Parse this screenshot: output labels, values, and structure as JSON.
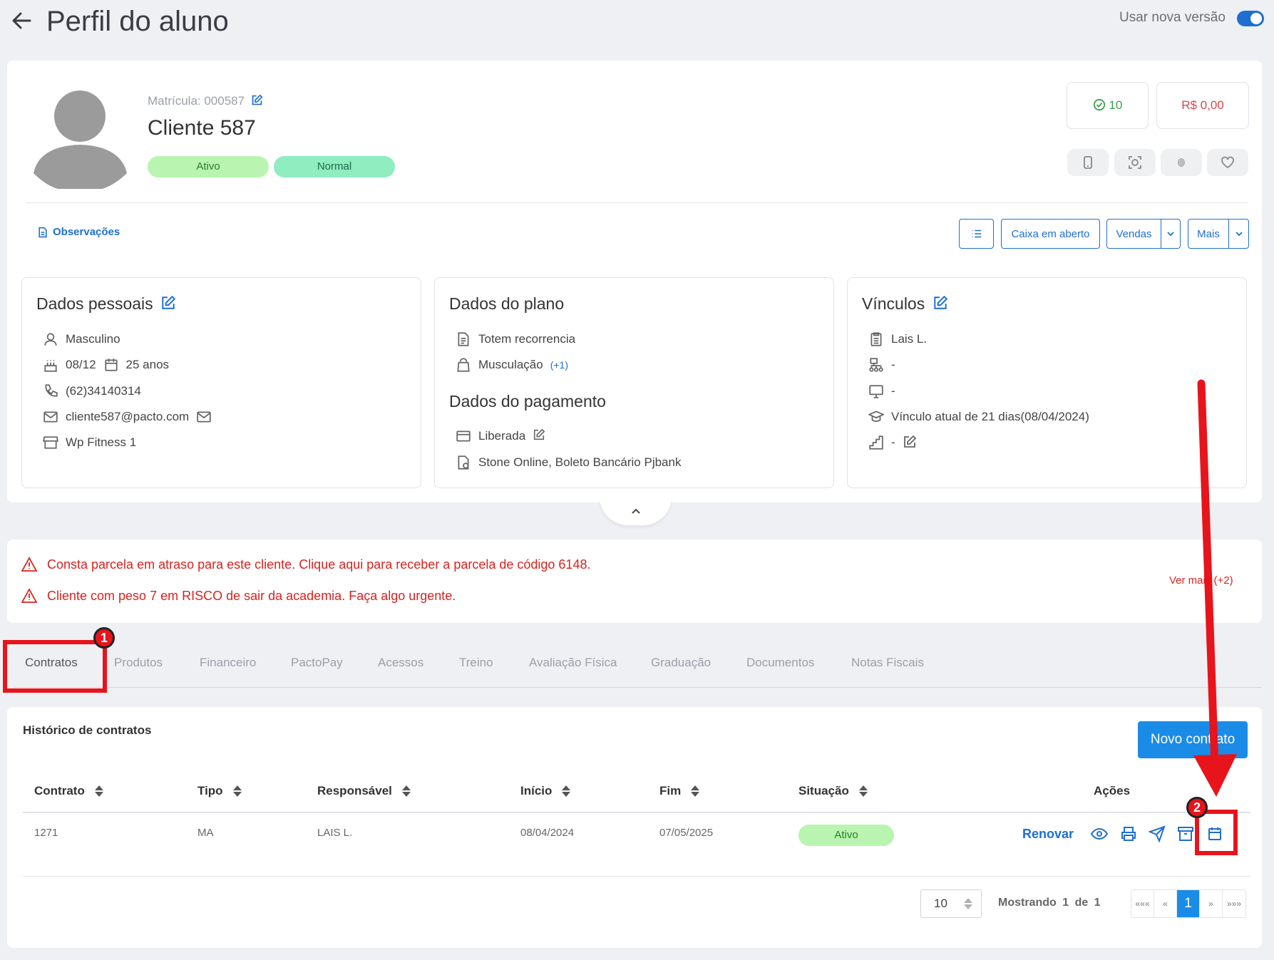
{
  "header": {
    "title": "Perfil do aluno",
    "toggle_label": "Usar nova versão",
    "toggle_on": true
  },
  "profile": {
    "matricula": "Matrícula: 000587",
    "name": "Cliente 587",
    "badges": [
      "Ativo",
      "Normal"
    ],
    "points": "10",
    "balance": "R$ 0,00",
    "observacoes": "Observações"
  },
  "toolbar": {
    "caixa": "Caixa em aberto",
    "vendas": "Vendas",
    "mais": "Mais"
  },
  "personal": {
    "title": "Dados pessoais",
    "gender": "Masculino",
    "birthday": "08/12",
    "age": "25 anos",
    "phone": "(62)34140314",
    "email": "cliente587@pacto.com",
    "unit": "Wp Fitness 1"
  },
  "plan": {
    "title": "Dados do plano",
    "name": "Totem recorrencia",
    "modality": "Musculação",
    "modality_extra": "(+1)",
    "payment_title": "Dados do pagamento",
    "payment_status": "Liberada",
    "payment_methods": "Stone Online, Boleto Bancário Pjbank"
  },
  "links": {
    "title": "Vínculos",
    "consultant": "Lais L.",
    "row2": "-",
    "row3": "-",
    "current": "Vínculo atual de 21 dias(08/04/2024)",
    "row5": "-"
  },
  "alerts": {
    "items": [
      "Consta parcela em atraso para este cliente. Clique aqui para receber a parcela de código 6148.",
      "Cliente com peso 7 em RISCO de sair da academia. Faça algo urgente."
    ],
    "more": "Ver mais (+2)"
  },
  "tabs": [
    "Contratos",
    "Produtos",
    "Financeiro",
    "PactoPay",
    "Acessos",
    "Treino",
    "Avaliação Física",
    "Graduação",
    "Documentos",
    "Notas Fiscais"
  ],
  "contracts": {
    "title": "Histórico de contratos",
    "new_button": "Novo contrato",
    "columns": [
      "Contrato",
      "Tipo",
      "Responsável",
      "Início",
      "Fim",
      "Situação",
      "Ações"
    ],
    "rows": [
      {
        "contrato": "1271",
        "tipo": "MA",
        "responsavel": "LAIS L.",
        "inicio": "08/04/2024",
        "fim": "07/05/2025",
        "situacao": "Ativo",
        "renovar": "Renovar"
      }
    ],
    "page_size": "10",
    "showing": "Mostrando 1 de 1",
    "pager": [
      "«««",
      "«",
      "1",
      "»",
      "»»»"
    ]
  },
  "annotations": {
    "step1": "1",
    "step2": "2",
    "color": "#e8141b"
  },
  "colors": {
    "primary": "#1f6fd0",
    "button": "#1a8ce8",
    "danger": "#d9231f",
    "success_bg": "#b9f5b0"
  }
}
